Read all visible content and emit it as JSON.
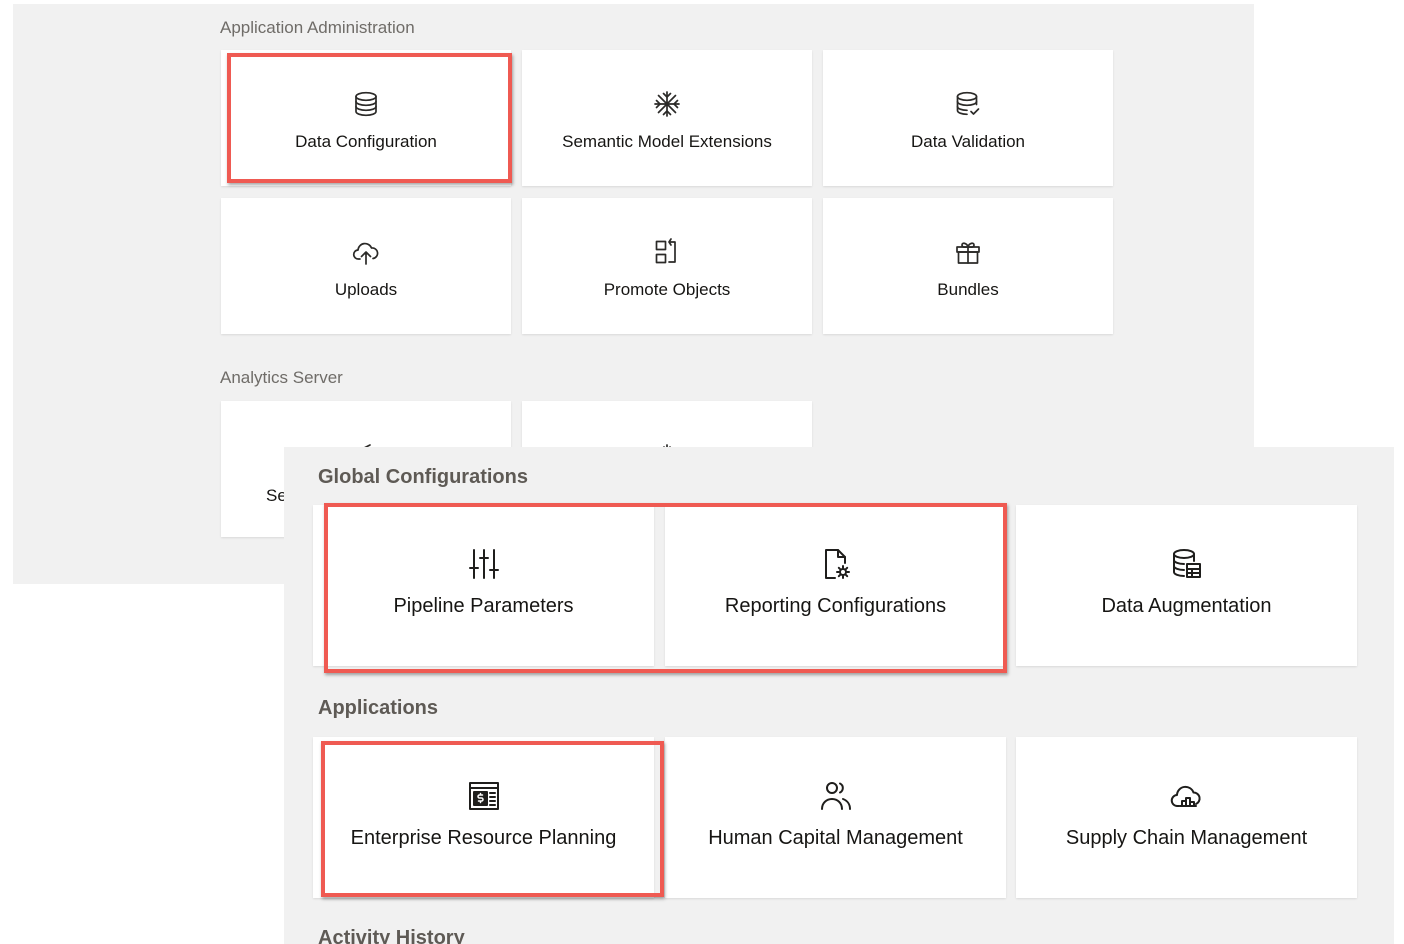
{
  "back_panel": {
    "sections": {
      "application_administration": {
        "title": "Application Administration",
        "tiles": [
          {
            "label": "Data Configuration",
            "icon": "database-icon"
          },
          {
            "label": "Semantic Model Extensions",
            "icon": "snowflake-icon"
          },
          {
            "label": "Data Validation",
            "icon": "database-check-icon"
          },
          {
            "label": "Uploads",
            "icon": "cloud-upload-icon"
          },
          {
            "label": "Promote Objects",
            "icon": "promote-objects-icon"
          },
          {
            "label": "Bundles",
            "icon": "gift-icon"
          }
        ]
      },
      "analytics_server": {
        "title": "Analytics Server",
        "tiles": [
          {
            "label_partial": "Se",
            "icon": "partial-icon"
          },
          {
            "label_partial": "",
            "icon": "partial-icon"
          }
        ]
      }
    }
  },
  "front_panel": {
    "sections": {
      "global_configurations": {
        "title": "Global Configurations",
        "tiles": [
          {
            "label": "Pipeline Parameters",
            "icon": "sliders-icon"
          },
          {
            "label": "Reporting Configurations",
            "icon": "file-gear-icon"
          },
          {
            "label": "Data Augmentation",
            "icon": "database-table-icon"
          }
        ]
      },
      "applications": {
        "title": "Applications",
        "tiles": [
          {
            "label": "Enterprise Resource Planning",
            "icon": "ledger-dollar-icon"
          },
          {
            "label": "Human Capital Management",
            "icon": "people-icon"
          },
          {
            "label": "Supply Chain Management",
            "icon": "cloud-chart-icon"
          }
        ]
      },
      "activity_history": {
        "title": "Activity History"
      }
    }
  },
  "colors": {
    "panel_background": "#f1f1f1",
    "tile_background": "#ffffff",
    "highlight_border": "#ef5a52",
    "text_primary": "#161513",
    "text_secondary": "#6f6c68"
  }
}
